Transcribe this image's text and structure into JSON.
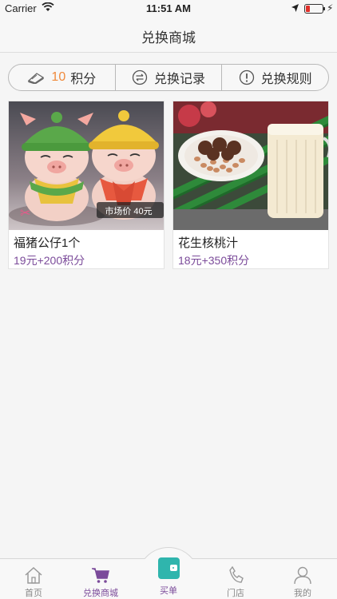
{
  "status_bar": {
    "carrier": "Carrier",
    "time": "11:51 AM"
  },
  "nav": {
    "title": "兑换商城"
  },
  "segment": {
    "points_value": "10",
    "points_label": "积分",
    "history_label": "兑换记录",
    "rules_label": "兑换规则"
  },
  "products": [
    {
      "name": "福猪公仔1个",
      "price": "19元+200积分",
      "image_text": "市场价 40元"
    },
    {
      "name": "花生核桃汁",
      "price": "18元+350积分"
    }
  ],
  "tabs": [
    {
      "label": "首页"
    },
    {
      "label": "兑换商城"
    },
    {
      "label": "买单"
    },
    {
      "label": "门店"
    },
    {
      "label": "我的"
    }
  ],
  "colors": {
    "accent": "#7b4b9a",
    "points": "#f08a3c",
    "wallet": "#2fb5ad"
  }
}
